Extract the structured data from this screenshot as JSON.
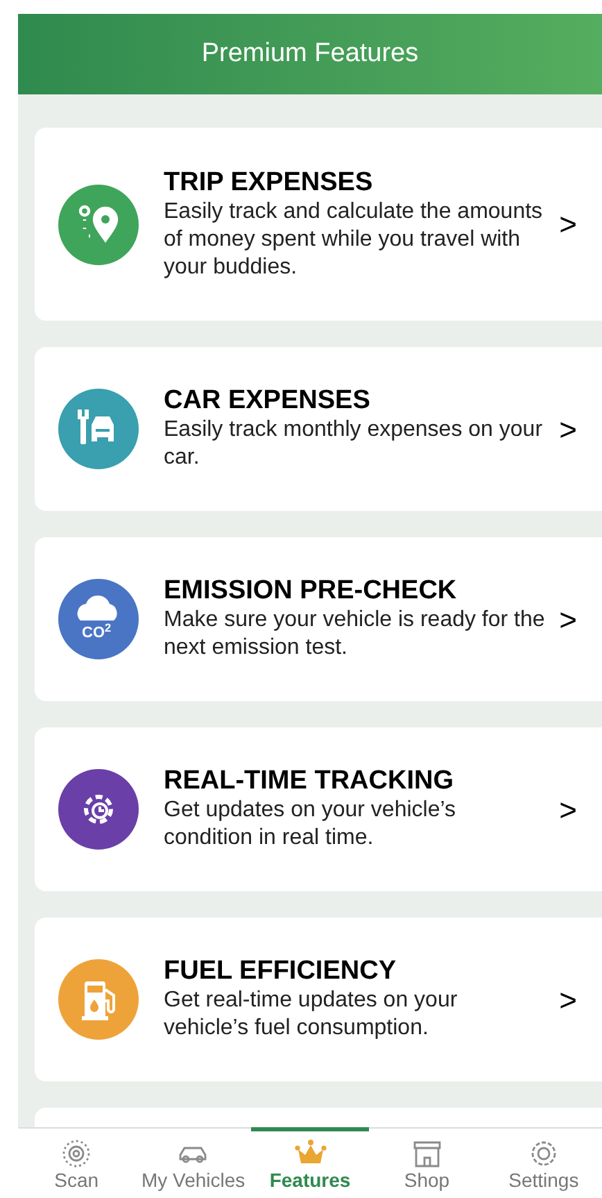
{
  "header": {
    "title": "Premium Features"
  },
  "features": [
    {
      "kind": "trip",
      "title": "TRIP EXPENSES",
      "description": "Easily track and calculate the amounts of money spent while you travel with your buddies.",
      "color": "#3fa55b",
      "chevron": ">"
    },
    {
      "kind": "car",
      "title": "CAR EXPENSES",
      "description": "Easily track monthly expenses on your car.",
      "color": "#3a9fae",
      "chevron": ">"
    },
    {
      "kind": "emission",
      "title": "EMISSION PRE-CHECK",
      "description": "Make sure your vehicle is ready for the next emission test.",
      "icon_text": "CO$^{2}$",
      "color": "#4a75c4",
      "chevron": ">"
    },
    {
      "kind": "tracking",
      "title": "REAL-TIME TRACKING",
      "description": "Get updates on your vehicle’s condition in real time.",
      "color": "#6a3fa8",
      "chevron": ">"
    },
    {
      "kind": "fuel",
      "title": "FUEL EFFICIENCY",
      "description": "Get real-time updates on your vehicle’s fuel consumption.",
      "color": "#eea33a",
      "chevron": ">"
    }
  ],
  "nav": [
    {
      "kind": "scan",
      "label": "Scan",
      "selected": false
    },
    {
      "kind": "vehicles",
      "label": "My Vehicles",
      "selected": false
    },
    {
      "kind": "features",
      "label": "Features",
      "selected": true
    },
    {
      "kind": "shop",
      "label": "Shop",
      "selected": false
    },
    {
      "kind": "settings",
      "label": "Settings",
      "selected": false
    }
  ]
}
